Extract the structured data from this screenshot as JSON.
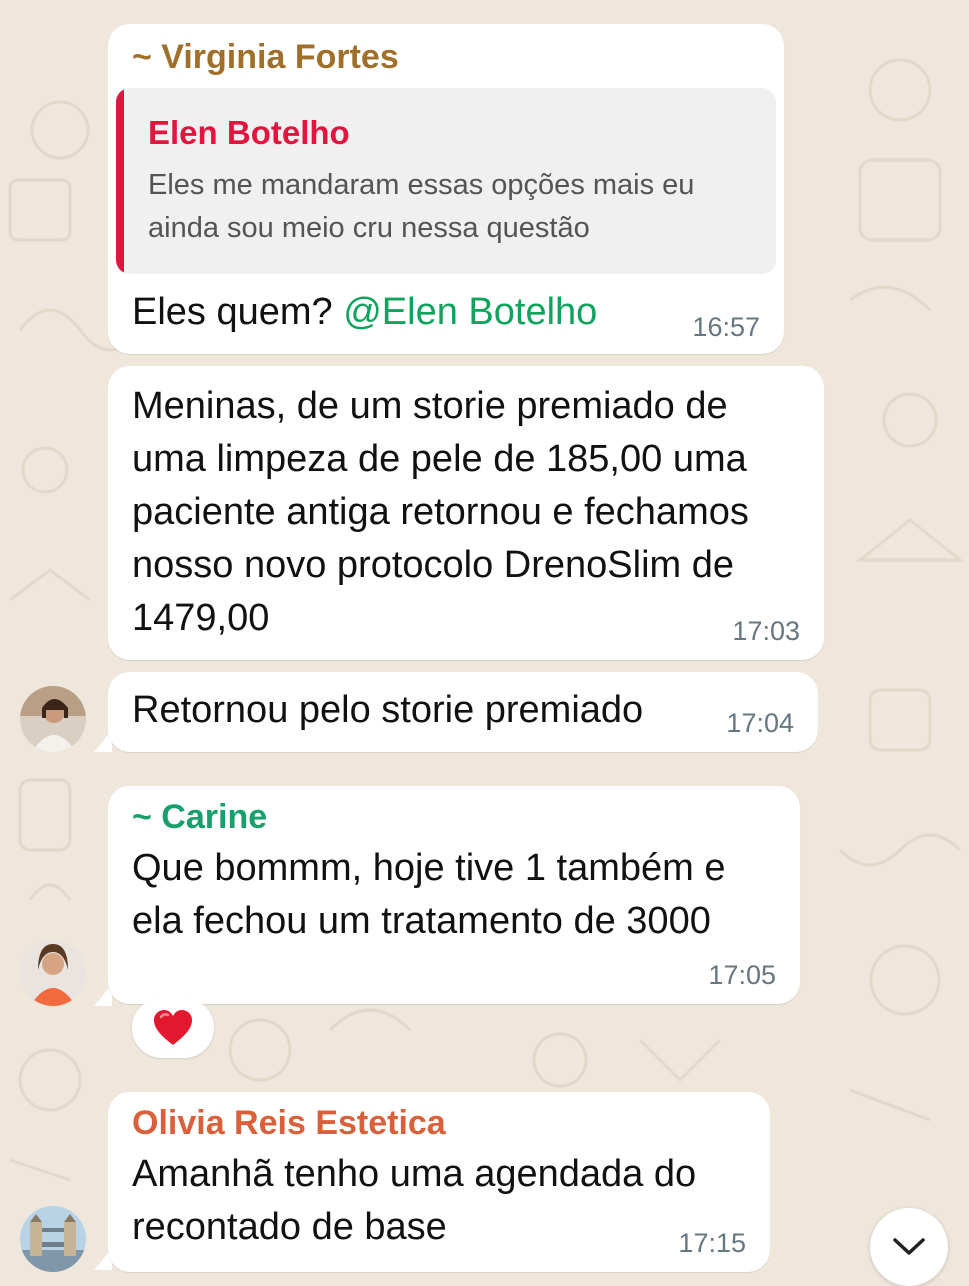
{
  "colors": {
    "background": "#efe7dc",
    "bubble": "#ffffff",
    "virginia": "#a0702a",
    "elen_quote": "#e2153f",
    "mention": "#10a35e",
    "carine": "#17a06b",
    "olivia": "#d9603b",
    "timestamp": "#667781"
  },
  "messages": [
    {
      "sender": "~ Virginia Fortes",
      "quoted": {
        "name": "Elen Botelho",
        "text": "Eles me mandaram essas opções mais eu ainda sou meio cru nessa questão"
      },
      "text_prefix": "Eles quem? ",
      "mention": "@Elen Botelho",
      "time": "16:57"
    },
    {
      "text": "Meninas, de um storie premiado de uma limpeza de pele de 185,00 uma paciente antiga retornou e fechamos nosso novo protocolo DrenoSlim de 1479,00",
      "time": "17:03"
    },
    {
      "text": "Retornou pelo storie premiado",
      "time": "17:04",
      "avatar_icon": "woman-avatar-icon"
    },
    {
      "sender": "~ Carine",
      "text": "Que bommm, hoje tive 1 também e ela fechou um tratamento de 3000",
      "time": "17:05",
      "avatar_icon": "woman-orange-dress-avatar-icon",
      "reaction": "❤️"
    },
    {
      "sender": "Olivia Reis Estetica",
      "text": "Amanhã tenho uma agendada do recontado de base",
      "time": "17:15",
      "avatar_icon": "tower-bridge-avatar-icon"
    }
  ],
  "scroll_button_icon": "chevron-down-icon"
}
